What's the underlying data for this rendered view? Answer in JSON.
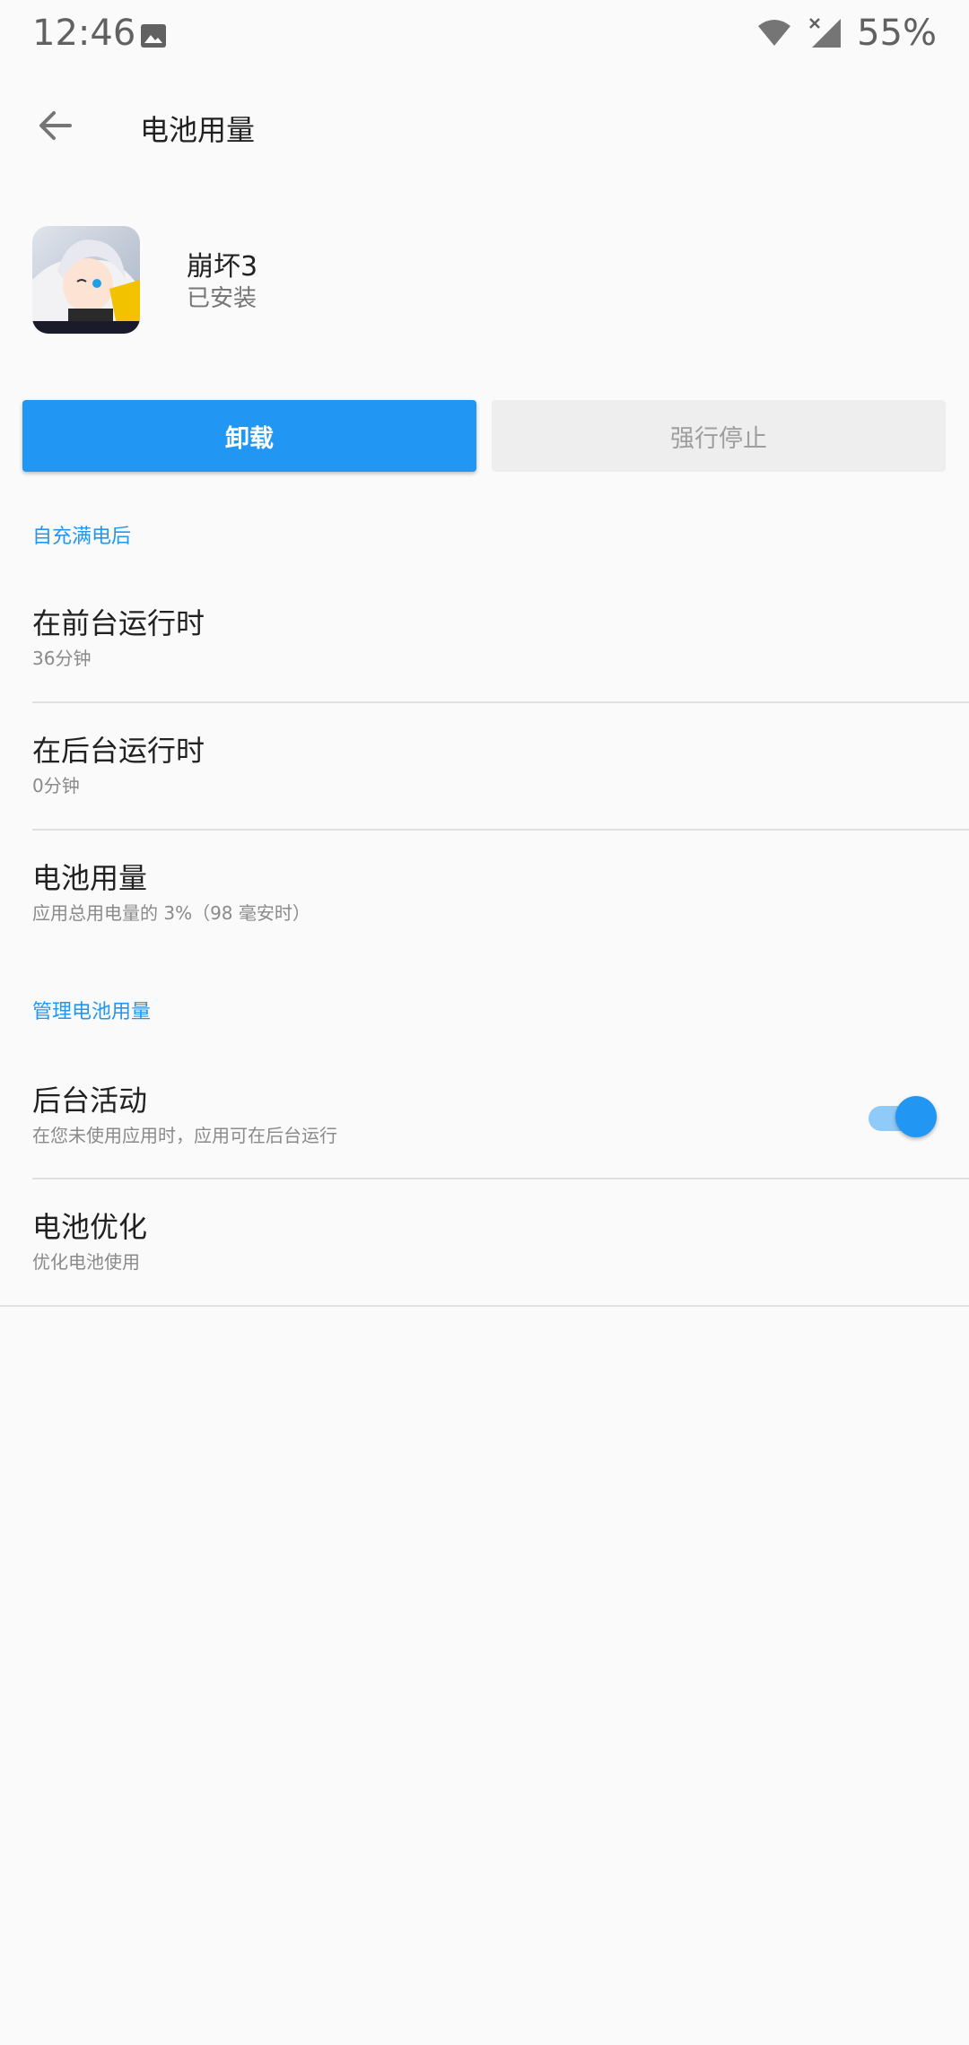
{
  "status_bar": {
    "time": "12:46",
    "battery": "55%",
    "icons": [
      "image-icon",
      "wifi-icon",
      "cell-signal-icon"
    ]
  },
  "toolbar": {
    "title": "电池用量",
    "back_icon": "back-arrow-icon"
  },
  "app": {
    "name": "崩坏3",
    "status": "已安装"
  },
  "buttons": {
    "uninstall": "卸载",
    "force_stop": "强行停止"
  },
  "section_charge": {
    "header": "自充满电后",
    "items": [
      {
        "title": "在前台运行时",
        "subtitle": "36分钟"
      },
      {
        "title": "在后台运行时",
        "subtitle": "0分钟"
      },
      {
        "title": "电池用量",
        "subtitle": "应用总用电量的 3%（98 毫安时）"
      }
    ]
  },
  "section_manage": {
    "header": "管理电池用量",
    "items": [
      {
        "title": "后台活动",
        "subtitle": "在您未使用应用时，应用可在后台运行",
        "toggle_on": true
      },
      {
        "title": "电池优化",
        "subtitle": "优化电池使用"
      }
    ]
  },
  "colors": {
    "accent": "#2196f3",
    "background": "#fafafa",
    "divider": "#e0e0e0"
  }
}
